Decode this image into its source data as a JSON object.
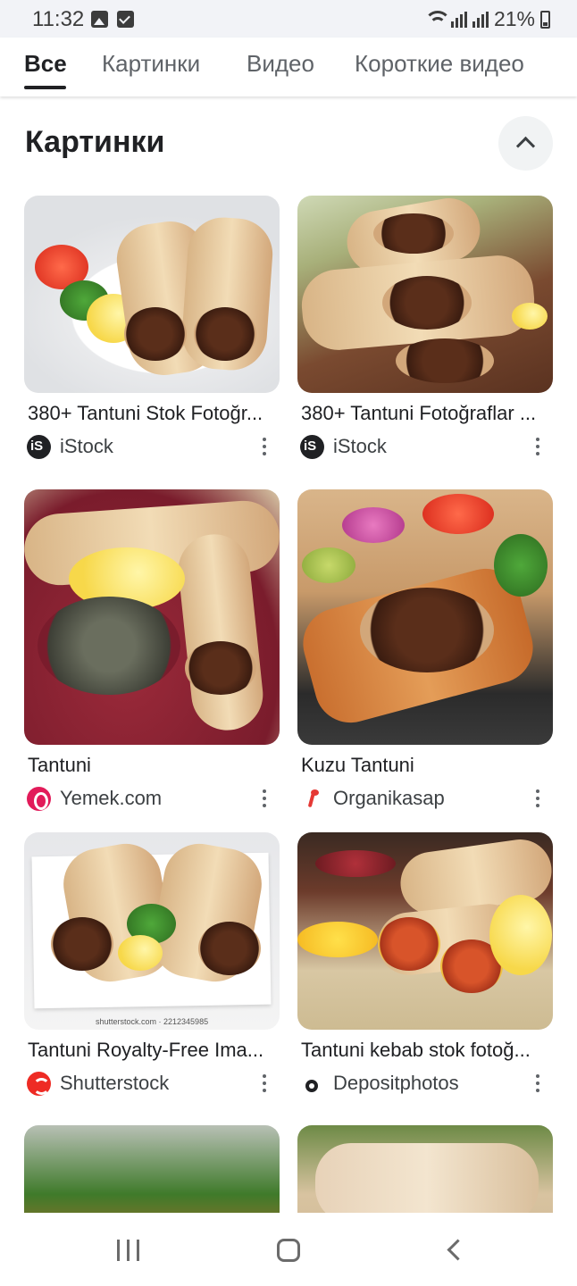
{
  "status_bar": {
    "time": "11:32",
    "battery": "21%",
    "icons": [
      "image-icon",
      "checkbox-icon",
      "wifi-icon",
      "signal-icon",
      "signal-icon",
      "battery-icon"
    ]
  },
  "tabs": [
    {
      "label": "Все",
      "active": true
    },
    {
      "label": "Картинки",
      "active": false
    },
    {
      "label": "Видео",
      "active": false
    },
    {
      "label": "Короткие видео",
      "active": false
    }
  ],
  "section": {
    "title": "Картинки",
    "collapse_icon": "chevron-up-icon"
  },
  "results": [
    {
      "title": "380+ Tantuni Stok Fotoğr...",
      "source": "iStock",
      "favicon": "istock-logo"
    },
    {
      "title": "380+ Tantuni Fotoğraflar ...",
      "source": "iStock",
      "favicon": "istock-logo"
    },
    {
      "title": "Tantuni",
      "source": "Yemek.com",
      "favicon": "yemek-logo"
    },
    {
      "title": "Kuzu Tantuni",
      "source": "Organikasap",
      "favicon": "organikasap-logo"
    },
    {
      "title": "Tantuni Royalty-Free Ima...",
      "source": "Shutterstock",
      "favicon": "shutterstock-logo",
      "watermark": "shutterstock.com · 2212345985"
    },
    {
      "title": "Tantuni kebab stok fotoğ...",
      "source": "Depositphotos",
      "favicon": "depositphotos-logo"
    }
  ],
  "nav_bar": {
    "icons": [
      "recent-apps-icon",
      "home-icon",
      "back-icon"
    ]
  }
}
